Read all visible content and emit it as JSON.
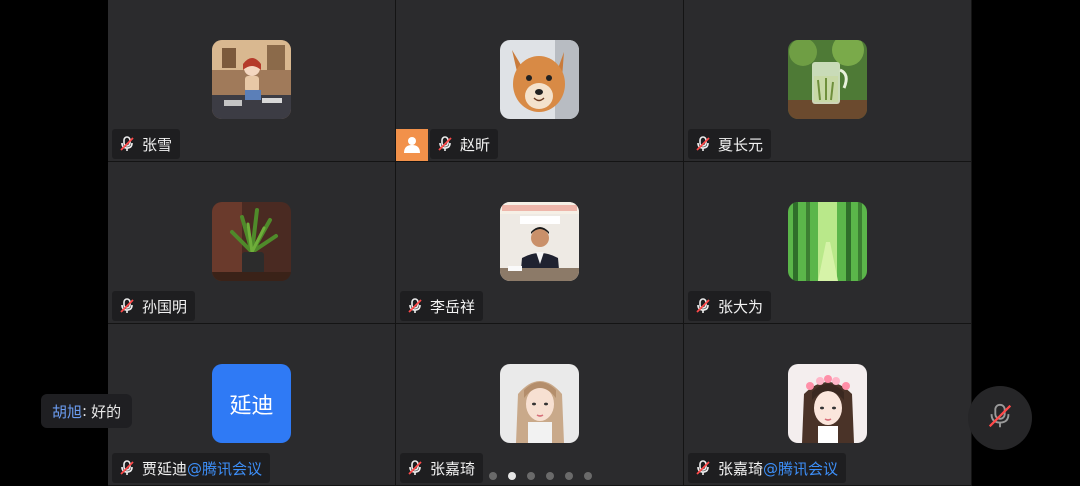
{
  "participants": [
    {
      "name": "张雪",
      "org": "",
      "avatar": "photo-girl-cartoon",
      "mic": "muted"
    },
    {
      "name": "赵昕",
      "org": "",
      "avatar": "photo-shiba-dog",
      "mic": "muted",
      "badge": "person-icon"
    },
    {
      "name": "夏长元",
      "org": "",
      "avatar": "photo-tea-glass",
      "mic": "muted"
    },
    {
      "name": "孙国明",
      "org": "",
      "avatar": "photo-plant",
      "mic": "muted"
    },
    {
      "name": "李岳祥",
      "org": "",
      "avatar": "photo-man-desk",
      "mic": "muted"
    },
    {
      "name": "张大为",
      "org": "",
      "avatar": "photo-forest",
      "mic": "muted"
    },
    {
      "name": "贾延迪",
      "org": "@腾讯会议",
      "avatar_text": "延迪",
      "avatar": "text-avatar",
      "mic": "muted"
    },
    {
      "name": "张嘉琦",
      "org": "",
      "avatar": "photo-girl-portrait",
      "mic": "muted"
    },
    {
      "name": "张嘉琦",
      "org": "@腾讯会议",
      "avatar": "photo-girl-flowers",
      "mic": "muted"
    }
  ],
  "chat": {
    "sender": "胡旭",
    "separator": ":",
    "message": "好的"
  },
  "pagination": {
    "total": 6,
    "current": 2
  },
  "colors": {
    "tile_bg": "#2b2b2d",
    "accent_blue": "#2f7af5",
    "org_blue": "#3d8ff8",
    "badge_orange": "#f2914a"
  }
}
